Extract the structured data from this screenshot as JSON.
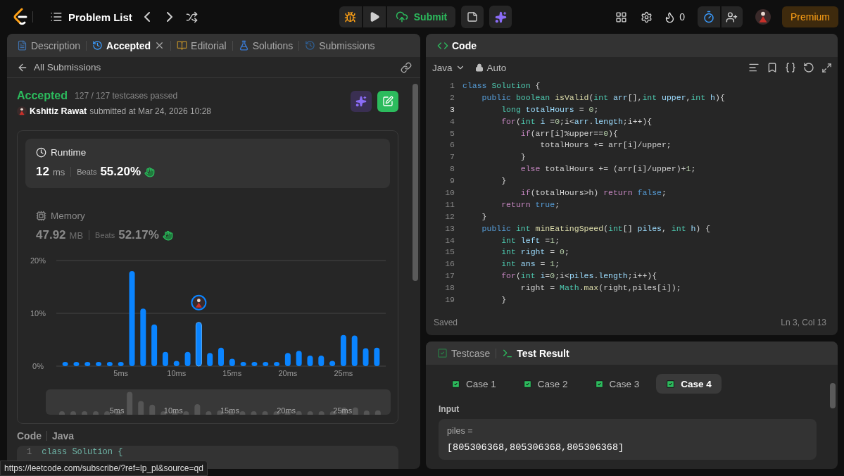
{
  "topbar": {
    "nav_title": "Problem List",
    "submit_label": "Submit",
    "streak_count": "0",
    "premium_label": "Premium"
  },
  "left_tabs": [
    {
      "label": "Description",
      "kind": "description",
      "selected": false,
      "closable": false
    },
    {
      "label": "Accepted",
      "kind": "accepted",
      "selected": true,
      "closable": true
    },
    {
      "label": "Editorial",
      "kind": "editorial",
      "selected": false,
      "closable": false
    },
    {
      "label": "Solutions",
      "kind": "solutions",
      "selected": false,
      "closable": false
    },
    {
      "label": "Submissions",
      "kind": "submissions",
      "selected": false,
      "closable": false
    }
  ],
  "back_link": "All Submissions",
  "submission": {
    "status": "Accepted",
    "passed": "127 / 127 testcases passed",
    "user": "Kshitiz Rawat",
    "submitted": "submitted at Mar 24, 2026 10:28"
  },
  "metrics": [
    {
      "kind": "runtime",
      "label": "Runtime",
      "value": "12",
      "unit": "ms",
      "beats_label": "Beats",
      "beats": "55.20%",
      "selected": true
    },
    {
      "kind": "memory",
      "label": "Memory",
      "value": "47.92",
      "unit": "MB",
      "beats_label": "Beats",
      "beats": "52.17%",
      "selected": false
    }
  ],
  "distribution": {
    "chart_data": {
      "type": "bar",
      "x": [
        0,
        1,
        2,
        3,
        4,
        5,
        6,
        7,
        8,
        9,
        10,
        11,
        12,
        13,
        14,
        15,
        16,
        17,
        18,
        19,
        20,
        21,
        22,
        23,
        24,
        25,
        26,
        27,
        28
      ],
      "series": [
        {
          "color": "#0a84ff",
          "values": [
            0.8,
            0.8,
            0.8,
            0.8,
            0.8,
            0.8,
            18.0,
            10.9,
            7.9,
            2.7,
            1.0,
            2.7,
            8.3,
            2.5,
            3.5,
            1.4,
            0.8,
            0.8,
            0.8,
            0.8,
            2.5,
            2.9,
            2.0,
            2.0,
            1.0,
            5.9,
            5.8,
            3.4,
            3.5
          ]
        }
      ],
      "xlim": [
        -0.8,
        28.8
      ],
      "ylim": [
        0,
        20
      ],
      "yticks": [
        {
          "value": 0,
          "label": "0%"
        },
        {
          "value": 10,
          "label": "10%"
        },
        {
          "value": 20,
          "label": "20%"
        }
      ],
      "xticks": [
        {
          "value": 5,
          "label": "5ms"
        },
        {
          "value": 10,
          "label": "10ms"
        },
        {
          "value": 15,
          "label": "15ms"
        },
        {
          "value": 20,
          "label": "20ms"
        },
        {
          "value": 25,
          "label": "25ms"
        }
      ]
    },
    "bars": [
      {
        "selected": false
      },
      {
        "selected": false
      },
      {
        "selected": false
      },
      {
        "selected": false
      },
      {
        "selected": false
      },
      {
        "selected": false
      },
      {
        "selected": false
      },
      {
        "selected": false
      },
      {
        "selected": false
      },
      {
        "selected": false
      },
      {
        "selected": false
      },
      {
        "selected": false
      },
      {
        "selected": true
      },
      {
        "selected": false
      },
      {
        "selected": false
      },
      {
        "selected": false
      },
      {
        "selected": false
      },
      {
        "selected": false
      },
      {
        "selected": false
      },
      {
        "selected": false
      },
      {
        "selected": false
      },
      {
        "selected": false
      },
      {
        "selected": false
      },
      {
        "selected": false
      },
      {
        "selected": false
      },
      {
        "selected": false
      },
      {
        "selected": false
      },
      {
        "selected": false
      },
      {
        "selected": false
      }
    ],
    "navigator_ticks": [
      "5ms",
      "10ms",
      "15ms",
      "20ms",
      "25ms"
    ]
  },
  "code_preview": {
    "title": "Code",
    "language": "Java",
    "line_number": "1",
    "line": "class Solution {"
  },
  "status_url": "https://leetcode.com/subscribe/?ref=lp_pl&source=qd",
  "editor": {
    "title": "Code",
    "language": "Java",
    "mode": "Auto",
    "status": "Saved",
    "cursor": "Ln 3, Col 13",
    "lines": [
      {
        "number": "1",
        "active": false,
        "tokens": [
          {
            "kind": "keyword",
            "text": "class"
          },
          {
            "kind": "type",
            "text": " Solution"
          },
          {
            "kind": "plain",
            "text": " {"
          }
        ]
      },
      {
        "number": "2",
        "active": false,
        "tokens": [
          {
            "kind": "keyword",
            "text": "    public"
          },
          {
            "kind": "type",
            "text": " boolean"
          },
          {
            "kind": "function",
            "text": " isValid"
          },
          {
            "kind": "plain",
            "text": "("
          },
          {
            "kind": "type",
            "text": "int"
          },
          {
            "kind": "variable",
            "text": " arr"
          },
          {
            "kind": "plain",
            "text": "[],"
          },
          {
            "kind": "type",
            "text": "int"
          },
          {
            "kind": "variable",
            "text": " upper"
          },
          {
            "kind": "plain",
            "text": ","
          },
          {
            "kind": "type",
            "text": "int"
          },
          {
            "kind": "variable",
            "text": " h"
          },
          {
            "kind": "plain",
            "text": "){"
          }
        ]
      },
      {
        "number": "3",
        "active": true,
        "tokens": [
          {
            "kind": "type",
            "text": "        long"
          },
          {
            "kind": "variable",
            "text": " totalHours"
          },
          {
            "kind": "plain",
            "text": " = "
          },
          {
            "kind": "number",
            "text": "0"
          },
          {
            "kind": "plain",
            "text": ";"
          }
        ]
      },
      {
        "number": "4",
        "active": false,
        "tokens": [
          {
            "kind": "control",
            "text": "        for"
          },
          {
            "kind": "plain",
            "text": "("
          },
          {
            "kind": "type",
            "text": "int"
          },
          {
            "kind": "variable",
            "text": " i"
          },
          {
            "kind": "plain",
            "text": " ="
          },
          {
            "kind": "number",
            "text": "0"
          },
          {
            "kind": "plain",
            "text": ";i<"
          },
          {
            "kind": "variable",
            "text": "arr"
          },
          {
            "kind": "plain",
            "text": "."
          },
          {
            "kind": "variable",
            "text": "length"
          },
          {
            "kind": "plain",
            "text": ";i++){"
          }
        ]
      },
      {
        "number": "5",
        "active": false,
        "tokens": [
          {
            "kind": "control",
            "text": "            if"
          },
          {
            "kind": "plain",
            "text": "(arr[i]%upper=="
          },
          {
            "kind": "number",
            "text": "0"
          },
          {
            "kind": "plain",
            "text": "){"
          }
        ]
      },
      {
        "number": "6",
        "active": false,
        "tokens": [
          {
            "kind": "plain",
            "text": "                totalHours += arr[i]/upper;"
          }
        ]
      },
      {
        "number": "7",
        "active": false,
        "tokens": [
          {
            "kind": "plain",
            "text": "            }"
          }
        ]
      },
      {
        "number": "8",
        "active": false,
        "tokens": [
          {
            "kind": "control",
            "text": "            else"
          },
          {
            "kind": "plain",
            "text": " totalHours += (arr[i]/upper)+"
          },
          {
            "kind": "number",
            "text": "1"
          },
          {
            "kind": "plain",
            "text": ";"
          }
        ]
      },
      {
        "number": "9",
        "active": false,
        "tokens": [
          {
            "kind": "plain",
            "text": "        }"
          }
        ]
      },
      {
        "number": "10",
        "active": false,
        "tokens": [
          {
            "kind": "control",
            "text": "            if"
          },
          {
            "kind": "plain",
            "text": "(totalHours>h) "
          },
          {
            "kind": "control",
            "text": "return"
          },
          {
            "kind": "keyword",
            "text": " false"
          },
          {
            "kind": "plain",
            "text": ";"
          }
        ]
      },
      {
        "number": "11",
        "active": false,
        "tokens": [
          {
            "kind": "control",
            "text": "        return"
          },
          {
            "kind": "keyword",
            "text": " true"
          },
          {
            "kind": "plain",
            "text": ";"
          }
        ]
      },
      {
        "number": "12",
        "active": false,
        "tokens": [
          {
            "kind": "plain",
            "text": "    }"
          }
        ]
      },
      {
        "number": "13",
        "active": false,
        "tokens": [
          {
            "kind": "keyword",
            "text": "    public"
          },
          {
            "kind": "type",
            "text": " int"
          },
          {
            "kind": "function",
            "text": " minEatingSpeed"
          },
          {
            "kind": "plain",
            "text": "("
          },
          {
            "kind": "type",
            "text": "int"
          },
          {
            "kind": "plain",
            "text": "[] "
          },
          {
            "kind": "variable",
            "text": "piles"
          },
          {
            "kind": "plain",
            "text": ", "
          },
          {
            "kind": "type",
            "text": "int"
          },
          {
            "kind": "variable",
            "text": " h"
          },
          {
            "kind": "plain",
            "text": ") {"
          }
        ]
      },
      {
        "number": "14",
        "active": false,
        "tokens": [
          {
            "kind": "type",
            "text": "        int"
          },
          {
            "kind": "variable",
            "text": " left"
          },
          {
            "kind": "plain",
            "text": " ="
          },
          {
            "kind": "number",
            "text": "1"
          },
          {
            "kind": "plain",
            "text": ";"
          }
        ]
      },
      {
        "number": "15",
        "active": false,
        "tokens": [
          {
            "kind": "type",
            "text": "        int"
          },
          {
            "kind": "variable",
            "text": " right"
          },
          {
            "kind": "plain",
            "text": " = "
          },
          {
            "kind": "number",
            "text": "0"
          },
          {
            "kind": "plain",
            "text": ";"
          }
        ]
      },
      {
        "number": "16",
        "active": false,
        "tokens": [
          {
            "kind": "type",
            "text": "        int"
          },
          {
            "kind": "variable",
            "text": " ans"
          },
          {
            "kind": "plain",
            "text": " = "
          },
          {
            "kind": "number",
            "text": "1"
          },
          {
            "kind": "plain",
            "text": ";"
          }
        ]
      },
      {
        "number": "17",
        "active": false,
        "tokens": [
          {
            "kind": "control",
            "text": "        for"
          },
          {
            "kind": "plain",
            "text": "("
          },
          {
            "kind": "type",
            "text": "int"
          },
          {
            "kind": "variable",
            "text": " i"
          },
          {
            "kind": "plain",
            "text": "="
          },
          {
            "kind": "number",
            "text": "0"
          },
          {
            "kind": "plain",
            "text": ";i<"
          },
          {
            "kind": "variable",
            "text": "piles"
          },
          {
            "kind": "plain",
            "text": "."
          },
          {
            "kind": "variable",
            "text": "length"
          },
          {
            "kind": "plain",
            "text": ";i++){"
          }
        ]
      },
      {
        "number": "18",
        "active": false,
        "tokens": [
          {
            "kind": "plain",
            "text": "            right = "
          },
          {
            "kind": "type",
            "text": "Math"
          },
          {
            "kind": "plain",
            "text": "."
          },
          {
            "kind": "function",
            "text": "max"
          },
          {
            "kind": "plain",
            "text": "(right,piles[i]);"
          }
        ]
      },
      {
        "number": "19",
        "active": false,
        "tokens": [
          {
            "kind": "plain",
            "text": "        }"
          }
        ]
      }
    ]
  },
  "result": {
    "tabs": [
      {
        "label": "Testcase",
        "kind": "testcase",
        "selected": false
      },
      {
        "label": "Test Result",
        "kind": "result",
        "selected": true
      }
    ],
    "cases": [
      {
        "label": "Case 1",
        "passed": true,
        "selected": false
      },
      {
        "label": "Case 2",
        "passed": true,
        "selected": false
      },
      {
        "label": "Case 3",
        "passed": true,
        "selected": false
      },
      {
        "label": "Case 4",
        "passed": true,
        "selected": true
      }
    ],
    "input_label": "Input",
    "param": "piles =",
    "value": "[805306368,805306368,805306368]"
  }
}
